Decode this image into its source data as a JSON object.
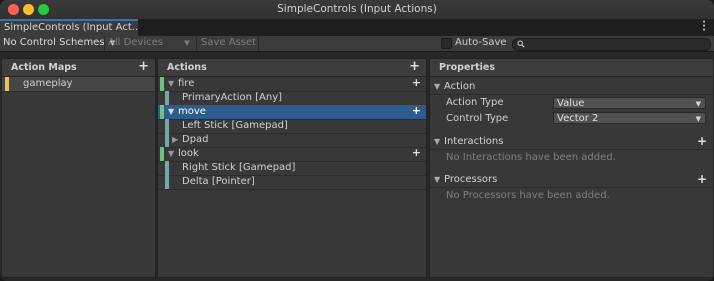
{
  "window": {
    "title": "SimpleControls (Input Actions)"
  },
  "tab": {
    "label": "SimpleControls (Input Act..."
  },
  "toolbar": {
    "control_scheme": "No Control Schemes",
    "devices": "All Devices",
    "save_asset": "Save Asset",
    "auto_save_label": "Auto-Save",
    "auto_save_checked": false,
    "search_value": ""
  },
  "action_maps": {
    "header": "Action Maps",
    "items": [
      {
        "label": "gameplay",
        "color": "#e8c15b"
      }
    ]
  },
  "actions": {
    "header": "Actions",
    "rows": [
      {
        "label": "fire",
        "kind": "action",
        "expanded": true
      },
      {
        "label": "PrimaryAction [Any]",
        "kind": "binding"
      },
      {
        "label": "move",
        "kind": "action",
        "expanded": true,
        "selected": true
      },
      {
        "label": "Left Stick [Gamepad]",
        "kind": "binding"
      },
      {
        "label": "Dpad",
        "kind": "composite",
        "expanded": false
      },
      {
        "label": "look",
        "kind": "action",
        "expanded": true
      },
      {
        "label": "Right Stick [Gamepad]",
        "kind": "binding"
      },
      {
        "label": "Delta [Pointer]",
        "kind": "binding"
      }
    ],
    "action_color": "#6fc082",
    "binding_color": "#74a8a3"
  },
  "properties": {
    "header": "Properties",
    "action_section": "Action",
    "action_type_label": "Action Type",
    "action_type_value": "Value",
    "control_type_label": "Control Type",
    "control_type_value": "Vector 2",
    "interactions_section": "Interactions",
    "interactions_empty": "No Interactions have been added.",
    "processors_section": "Processors",
    "processors_empty": "No Processors have been added."
  }
}
